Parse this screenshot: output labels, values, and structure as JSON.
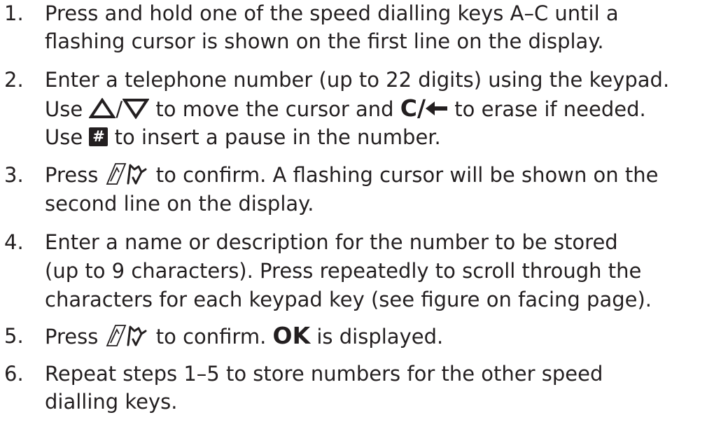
{
  "steps": [
    {
      "number": "1.",
      "line1": "Press and hold one of the speed dialling keys A–C until a",
      "line2": "flashing cursor is shown on the first line on the display."
    },
    {
      "number": "2.",
      "line1": "Enter a telephone number (up to 22 digits) using the keypad.",
      "line2_use": "Use",
      "line2_slash": "/",
      "line2_mid": "to move the cursor and",
      "line2_c_key": "C/",
      "line2_end": "to erase if needed.",
      "line3_use": "Use",
      "line3_key": "#",
      "line3_end": "to insert a pause in the number."
    },
    {
      "number": "3.",
      "line1_press": "Press",
      "line1_end": "to confirm. A flashing cursor will be shown on the",
      "line2": "second line on the display."
    },
    {
      "number": "4.",
      "line1": "Enter a name or description for the number to be stored",
      "line2": "(up to 9 characters). Press repeatedly to scroll through the",
      "line3": "characters for each keypad key (see figure on facing page)."
    },
    {
      "number": "5.",
      "line1_press": "Press",
      "line1_mid": "to confirm.",
      "line1_ok": "OK",
      "line1_end": "is displayed."
    },
    {
      "number": "6.",
      "line1": "Repeat steps 1–5 to store numbers for the other speed",
      "line2": "dialling keys."
    }
  ],
  "icons": [
    "up-triangle-icon",
    "down-triangle-icon",
    "left-arrow-icon",
    "call-key-icon"
  ],
  "colors": {
    "text": "#231f20",
    "background": "#ffffff"
  }
}
